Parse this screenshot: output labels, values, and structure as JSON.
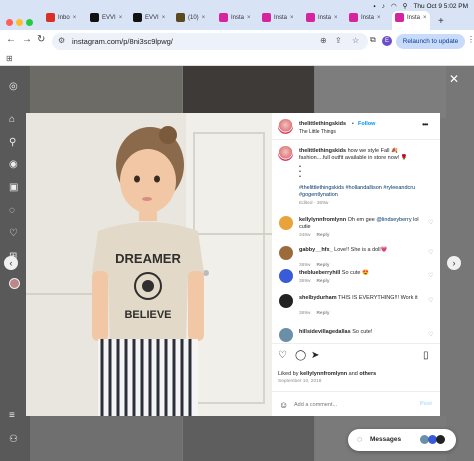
{
  "browser": {
    "tabs": [
      {
        "label": "Inbo",
        "color": "#d93025"
      },
      {
        "label": "EVVI",
        "color": "#111111"
      },
      {
        "label": "EVVI",
        "color": "#111111"
      },
      {
        "label": "(10)",
        "color": "#5b4a1e"
      },
      {
        "label": "Insta",
        "color": "#d6249f"
      },
      {
        "label": "Insta",
        "color": "#d6249f"
      },
      {
        "label": "Insta",
        "color": "#d6249f"
      },
      {
        "label": "Insta",
        "color": "#d6249f"
      },
      {
        "label": "Insta",
        "color": "#d6249f"
      }
    ],
    "clock": "Thu Oct 9  5:02 PM",
    "url": "instagram.com/p/8ni3sc9lpwg/",
    "profile_initial": "E",
    "relaunch_label": "Relaunch to update"
  },
  "post": {
    "username": "thelittlethingskids",
    "follow_label": "Follow",
    "dot": "•",
    "subtitle": "The Little Things",
    "caption": "how we style Fall 🍂 fashion....full outfit available in store now! 🌹",
    "dots": "•\n•\n•",
    "hashtags": "#thelittlethingskids #hollandallison #ryleeandcru #gogentlynation",
    "edited": "Edited · 369w",
    "comments": [
      {
        "user": "kellylynnfromlynn",
        "text": "Oh em gee",
        "mention": "@lindseyberry",
        "text2": "lol cutie",
        "time": "348w",
        "reply": "Reply",
        "color": "#e8a33a"
      },
      {
        "user": "gabby__hfx_",
        "text": "Love!! She is a doll💗",
        "time": "369w",
        "reply": "Reply",
        "color": "#9c6b3c"
      },
      {
        "user": "theblueberryhill",
        "text": "So cute 😍",
        "time": "369w",
        "reply": "Reply",
        "color": "#3a5bd9"
      },
      {
        "user": "shelbydurham",
        "text": "THIS IS EVERYTHING!!! Work it",
        "time": "369w",
        "reply": "Reply",
        "color": "#222222"
      },
      {
        "user": "hillsidevillagedallas",
        "text": "So cute!",
        "time": "",
        "reply": "",
        "color": "#6b8fa8"
      }
    ],
    "liked_by_prefix": "Liked by",
    "liked_by_user": "kellylynnfromlynn",
    "liked_by_and": "and",
    "liked_by_others": "others",
    "date": "September 10, 2018",
    "add_comment_placeholder": "Add a comment...",
    "post_label": "Post"
  },
  "shirt_text": {
    "top": "DREAMER",
    "bottom": "BELIEVE"
  },
  "messages": {
    "label": "Messages"
  }
}
